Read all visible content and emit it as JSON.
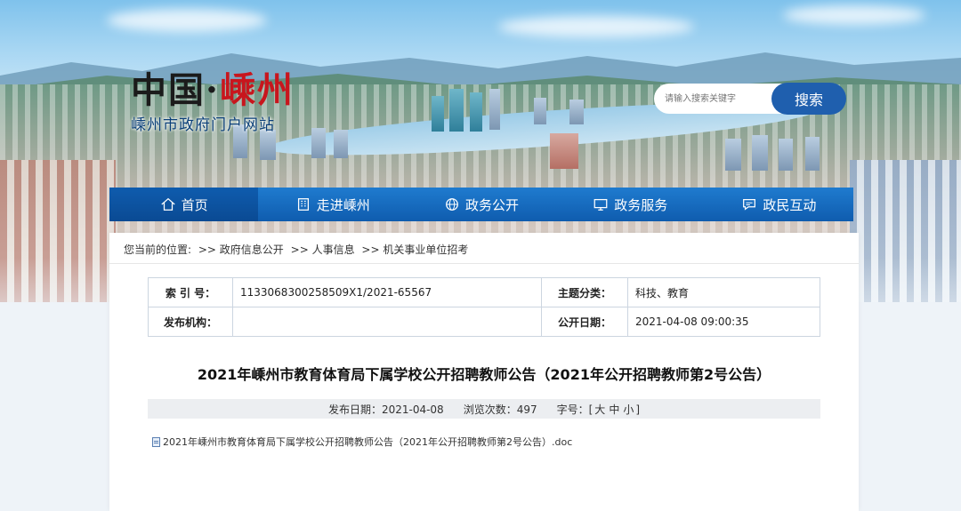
{
  "site": {
    "logo_part1": "中国·",
    "logo_part2": "嵊州",
    "subtitle": "嵊州市政府门户网站"
  },
  "search": {
    "placeholder": "请输入搜索关键字",
    "button": "搜索"
  },
  "nav": {
    "items": [
      {
        "label": "首页",
        "icon": "home-icon"
      },
      {
        "label": "走进嵊州",
        "icon": "building-icon"
      },
      {
        "label": "政务公开",
        "icon": "globe-icon"
      },
      {
        "label": "政务服务",
        "icon": "monitor-icon"
      },
      {
        "label": "政民互动",
        "icon": "chat-icon"
      }
    ]
  },
  "breadcrumb": {
    "prefix": "您当前的位置:",
    "items": [
      ">> 政府信息公开",
      ">> 人事信息",
      ">> 机关事业单位招考"
    ]
  },
  "meta": {
    "index_label": "索 引 号：",
    "index_value": "1133068300258509X1/2021-65567",
    "topic_label": "主题分类：",
    "topic_value": "科技、教育",
    "org_label": "发布机构：",
    "org_value": "",
    "date_label": "公开日期：",
    "date_value": "2021-04-08 09:00:35"
  },
  "article": {
    "title": "2021年嵊州市教育体育局下属学校公开招聘教师公告（2021年公开招聘教师第2号公告）",
    "publish_date": "发布日期：2021-04-08",
    "views": "浏览次数：497",
    "font_label": "字号：[",
    "font_large": "大",
    "font_medium": "中",
    "font_small": "小",
    "font_end": "]",
    "attachment": "2021年嵊州市教育体育局下属学校公开招聘教师公告（2021年公开招聘教师第2号公告）.doc"
  },
  "colors": {
    "nav_blue": "#0f5cae",
    "search_blue": "#1f5fae",
    "logo_red": "#c8161d",
    "subtitle_blue": "#0a3f78"
  }
}
